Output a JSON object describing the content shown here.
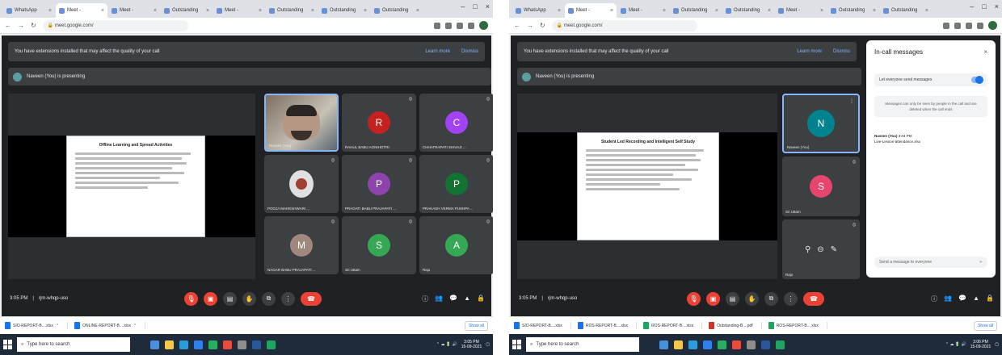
{
  "left": {
    "tabs": [
      "WhatsApp",
      "Meet -",
      "Meet -",
      "Outstanding",
      "Meet -",
      "Outstanding",
      "Outstanding",
      "Outstanding"
    ],
    "url": "meet.google.com/",
    "banner_text": "You have extensions installed that may affect the quality of your call",
    "banner_links": [
      "Learn more",
      "Dismiss"
    ],
    "presenting": "Naveen (You) is presenting",
    "slide_title": "Offline Learning and Spread Activities",
    "tiles": [
      {
        "name": "Naveen (You)",
        "type": "camera"
      },
      {
        "name": "RAHUL BABU AGNIHOTRI",
        "letter": "R",
        "color": "#c5221f"
      },
      {
        "name": "CHHATRAPATI SHIVAJI ...",
        "letter": "C",
        "color": "#a142f4"
      },
      {
        "name": "POOJA MAHESHWARI ...",
        "type": "photo"
      },
      {
        "name": "PRAGATI BABU PRAJAPATI ...",
        "letter": "P",
        "color": "#8e44ad"
      },
      {
        "name": "PRAKASH VERMA PUSHPA ...",
        "letter": "P",
        "color": "#137333"
      },
      {
        "name": "NAGAR BABU PRAJAPATI ...",
        "letter": "M",
        "color": "#a1887f"
      },
      {
        "name": "Sri Uttam",
        "letter": "S",
        "color": "#34a853"
      },
      {
        "name": "Raju",
        "letter": "A",
        "color": "#34a853"
      }
    ],
    "time": "3:05 PM",
    "meeting_code": "rjm-whqp-uso",
    "downloads": [
      "SIO-REPORT-B....xlsx",
      "ONLINE-REPORT-B....xlsx"
    ],
    "show_all": "Show all",
    "search_placeholder": "Type here to search",
    "clock_time": "3:05 PM",
    "clock_date": "15-09-2021"
  },
  "right": {
    "tabs": [
      "WhatsApp",
      "Meet -",
      "Meet -",
      "Outstanding",
      "Outstanding",
      "Meet -",
      "Outstanding",
      "Outstanding"
    ],
    "url": "meet.google.com/",
    "banner_text": "You have extensions installed that may affect the quality of your call",
    "banner_links": [
      "Learn more",
      "Dismiss"
    ],
    "presenting": "Naveen (You) is presenting",
    "slide_title": "Student Led Recording and Intelligent Self Study",
    "tiles": [
      {
        "name": "Naveen (You)",
        "letter": "N",
        "color": "#00838f"
      },
      {
        "name": "Sri Uttam",
        "letter": "S",
        "color": "#e8456e"
      },
      {
        "name": "Raju",
        "type": "icons"
      }
    ],
    "chat": {
      "title": "In-call messages",
      "toggle_label": "Let everyone send messages",
      "note": "Messages can only be seen by people in the call and are deleted when the call ends",
      "sender": "Naveen (You)",
      "sender_time": "3:04 PM",
      "message": "Live-Lesson-attendance.xlsx",
      "input_placeholder": "Send a message to everyone"
    },
    "time": "3:05 PM",
    "meeting_code": "rjm-whqp-uso",
    "downloads": [
      "SIO-REPORT-B....xlsx",
      "ROS-REPORT-B....xlsx",
      "ROS-REPORT-B....xlsx",
      "Outstanding-B....pdf",
      "ROS-REPORT-B....xlsx"
    ],
    "show_all": "Show all",
    "search_placeholder": "Type here to search",
    "clock_time": "3:06 PM",
    "clock_date": "15-09-2021"
  }
}
